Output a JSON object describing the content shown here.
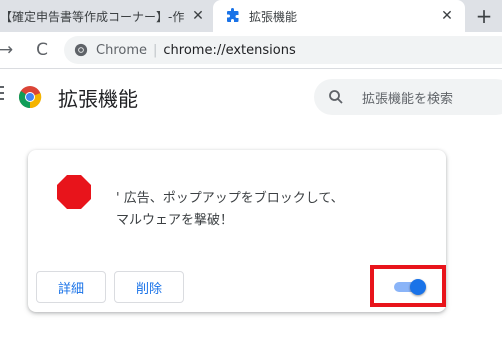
{
  "tabs": [
    {
      "title": "【確定申告書等作成コーナー】-作成コ",
      "close": "✕",
      "active": false
    },
    {
      "title": "拡張機能",
      "close": "✕",
      "active": true,
      "icon": "puzzle-icon"
    }
  ],
  "new_tab": "+",
  "toolbar": {
    "back": "→",
    "reload": "C",
    "site_name": "Chrome",
    "separator": "|",
    "url": "chrome://extensions"
  },
  "header": {
    "title": "拡張機能",
    "search_placeholder": "拡張機能を検索"
  },
  "extension": {
    "description": "' 広告、ポップアップをブロックして、\nマルウェアを撃破！",
    "details_label": "詳細",
    "remove_label": "削除",
    "enabled": true
  },
  "colors": {
    "accent": "#1a73e8",
    "highlight": "#e8141b",
    "stop_sign": "#e8141b"
  }
}
